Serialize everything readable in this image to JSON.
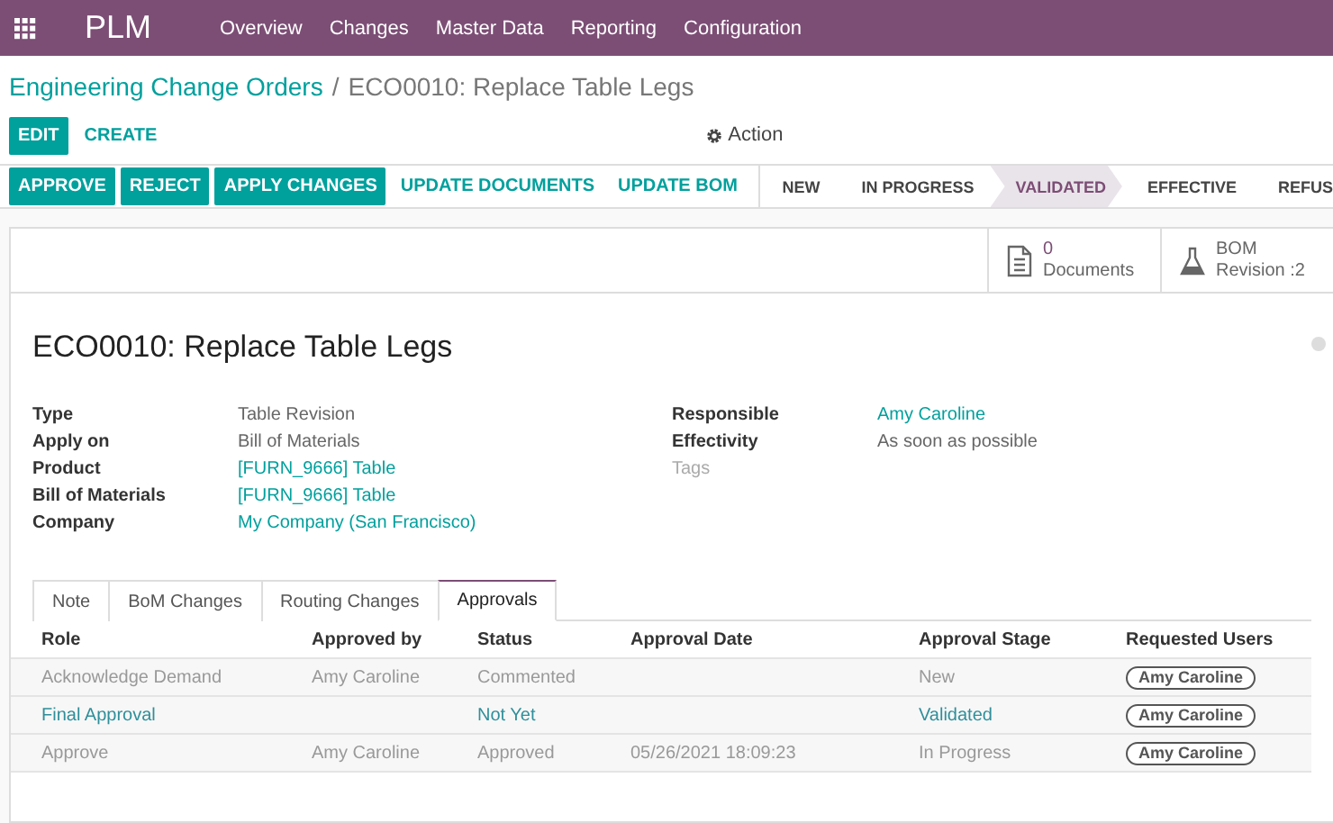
{
  "app": {
    "name": "PLM",
    "menu": [
      "Overview",
      "Changes",
      "Master Data",
      "Reporting",
      "Configuration"
    ]
  },
  "breadcrumb": {
    "parent": "Engineering Change Orders",
    "separator": "/",
    "current": "ECO0010: Replace Table Legs"
  },
  "control_buttons": [
    {
      "label": "EDIT",
      "primary": true
    },
    {
      "label": "CREATE",
      "primary": false
    }
  ],
  "action_menu": "Action",
  "header_buttons": [
    {
      "label": "APPROVE",
      "primary": true
    },
    {
      "label": "REJECT",
      "primary": true
    },
    {
      "label": "APPLY CHANGES",
      "primary": true
    },
    {
      "label": "UPDATE DOCUMENTS",
      "primary": false
    },
    {
      "label": "UPDATE BOM",
      "primary": false
    }
  ],
  "stages": [
    {
      "label": "NEW",
      "selected": false
    },
    {
      "label": "IN PROGRESS",
      "selected": false
    },
    {
      "label": "VALIDATED",
      "selected": true
    },
    {
      "label": "EFFECTIVE",
      "selected": false
    },
    {
      "label": "REFUS",
      "selected": false
    }
  ],
  "smart_buttons": [
    {
      "kind": "documents",
      "count": "0",
      "label": "Documents"
    },
    {
      "kind": "bom",
      "count": "BOM",
      "label": "Revision :2"
    }
  ],
  "title": "ECO0010: Replace Table Legs",
  "fields_left": [
    {
      "label": "Type",
      "value": "Table Revision",
      "link": false
    },
    {
      "label": "Apply on",
      "value": "Bill of Materials",
      "link": false
    },
    {
      "label": "Product",
      "value": "[FURN_9666] Table",
      "link": true
    },
    {
      "label": "Bill of Materials",
      "value": "[FURN_9666] Table",
      "link": true
    },
    {
      "label": "Company",
      "value": "My Company (San Francisco)",
      "link": true
    }
  ],
  "fields_right": [
    {
      "label": "Responsible",
      "value": "Amy Caroline",
      "link": true
    },
    {
      "label": "Effectivity",
      "value": "As soon as possible",
      "link": false
    },
    {
      "label": "Tags",
      "placeholder": true
    }
  ],
  "tabs": [
    {
      "label": "Note",
      "selected": false
    },
    {
      "label": "BoM Changes",
      "selected": false
    },
    {
      "label": "Routing Changes",
      "selected": false
    },
    {
      "label": "Approvals",
      "selected": true
    }
  ],
  "table": {
    "columns": [
      "Role",
      "Approved by",
      "Status",
      "Approval Date",
      "Approval Stage",
      "Requested Users"
    ],
    "rows": [
      {
        "pending": false,
        "cells": [
          "Acknowledge Demand",
          "Amy Caroline",
          "Commented",
          "",
          "New"
        ],
        "users": [
          "Amy Caroline"
        ]
      },
      {
        "pending": true,
        "cells": [
          "Final Approval",
          "",
          "Not Yet",
          "",
          "Validated"
        ],
        "users": [
          "Amy Caroline"
        ]
      },
      {
        "pending": false,
        "cells": [
          "Approve",
          "Amy Caroline",
          "Approved",
          "05/26/2021 18:09:23",
          "In Progress"
        ],
        "users": [
          "Amy Caroline"
        ]
      }
    ]
  }
}
